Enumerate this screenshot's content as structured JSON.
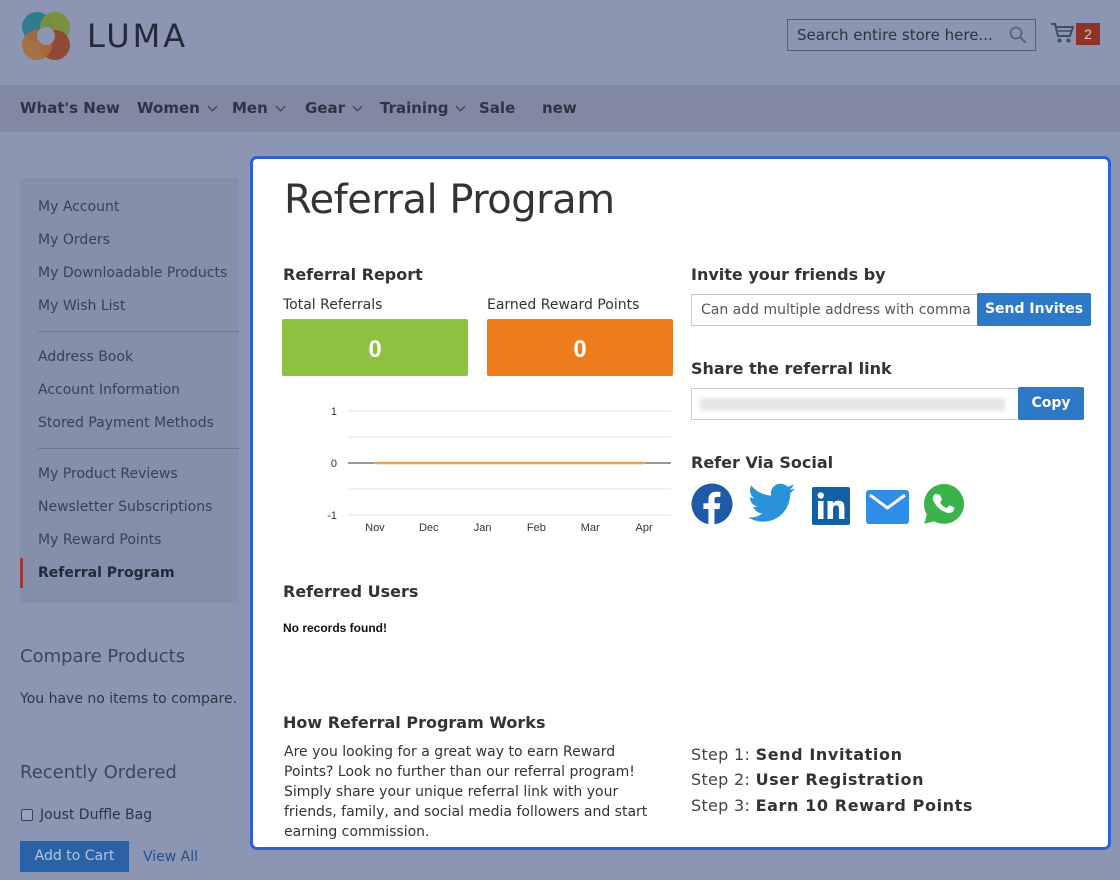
{
  "header": {
    "logo_text": "LUMA",
    "search_placeholder": "Search entire store here...",
    "cart_count": "2"
  },
  "nav": {
    "items": [
      {
        "label": "What's New",
        "has_dropdown": false
      },
      {
        "label": "Women",
        "has_dropdown": true
      },
      {
        "label": "Men",
        "has_dropdown": true
      },
      {
        "label": "Gear",
        "has_dropdown": true
      },
      {
        "label": "Training",
        "has_dropdown": true
      },
      {
        "label": "Sale",
        "has_dropdown": false
      },
      {
        "label": "new",
        "has_dropdown": false
      }
    ]
  },
  "sidebar": {
    "items": [
      "My Account",
      "My Orders",
      "My Downloadable Products",
      "My Wish List",
      "Address Book",
      "Account Information",
      "Stored Payment Methods",
      "My Product Reviews",
      "Newsletter Subscriptions",
      "My Reward Points",
      "Referral Program"
    ],
    "active": "Referral Program"
  },
  "compare": {
    "title": "Compare Products",
    "empty_text": "You have no items to compare."
  },
  "recent": {
    "title": "Recently Ordered",
    "item_label": "Joust Duffle Bag",
    "add_to_cart": "Add to Cart",
    "view_all": "View All"
  },
  "modal": {
    "title": "Referral Program",
    "report_title": "Referral Report",
    "total_label": "Total Referrals",
    "total_value": "0",
    "earned_label": "Earned Reward Points",
    "earned_value": "0",
    "invite_title": "Invite your friends by",
    "invite_placeholder": "Can add multiple address with comma",
    "send_button": "Send Invites",
    "share_title": "Share the referral link",
    "copy_button": "Copy",
    "social_title": "Refer Via Social",
    "social_icons": [
      "facebook-icon",
      "twitter-icon",
      "linkedin-icon",
      "email-icon",
      "whatsapp-icon"
    ],
    "referred_title": "Referred Users",
    "no_records": "No records found!",
    "how_title": "How Referral Program Works",
    "how_text": "Are you looking for a great way to earn Reward Points? Look no further than our referral program! Simply share your unique referral link with your friends, family, and social media followers and start earning commission.",
    "steps": [
      {
        "prefix": "Step 1:",
        "label": "Send Invitation"
      },
      {
        "prefix": "Step 2:",
        "label": "User Registration"
      },
      {
        "prefix": "Step 3:",
        "label": "Earn 10 Reward Points"
      }
    ]
  },
  "colors": {
    "total_box": "#8dc13f",
    "earned_box": "#ee7b1c",
    "button_blue": "#2d79c7",
    "modal_border": "#2f5fd6",
    "line_series": "#e8a04a"
  },
  "chart_data": {
    "type": "line",
    "categories": [
      "Nov",
      "Dec",
      "Jan",
      "Feb",
      "Mar",
      "Apr"
    ],
    "values": [
      0,
      0,
      0,
      0,
      0,
      0
    ],
    "y_ticks": [
      1,
      0,
      -1
    ],
    "ylim": [
      -1,
      1
    ],
    "grid": true
  }
}
